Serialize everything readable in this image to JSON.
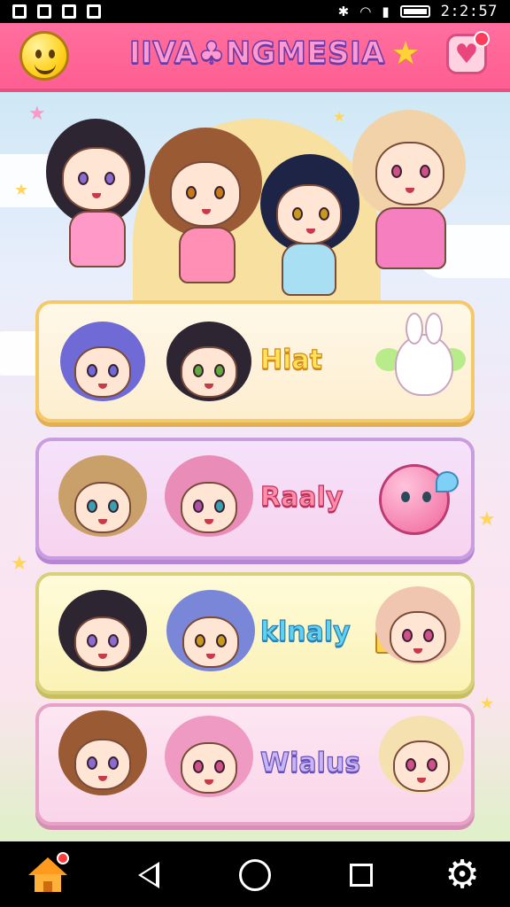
{
  "status_bar": {
    "time": "2:2:57",
    "icons": [
      "image-icon",
      "image-icon",
      "camera-icon",
      "app-icon",
      "bluetooth-icon",
      "wifi-icon",
      "signal-icon",
      "battery-icon"
    ]
  },
  "header": {
    "title": "IIVA♣NGMESIA",
    "left_icon": "smiley-icon",
    "star_icon": "star-icon",
    "right_icon": "heart-icon",
    "notification": true
  },
  "cards": [
    {
      "label": "Hiat",
      "accent": "#f5c96a",
      "right_icon": "bunny-icon"
    },
    {
      "label": "Raaly",
      "accent": "#c99ee0",
      "right_icon": "blob-icon"
    },
    {
      "label": "klnaly",
      "accent": "#d8d07a",
      "right_icon": "tag-icon"
    },
    {
      "label": "Wialus",
      "accent": "#e7a3c7",
      "right_icon": "character-icon"
    }
  ],
  "navbar": {
    "items": [
      "home-icon",
      "back-icon",
      "home-circle-icon",
      "recents-icon",
      "gear-icon"
    ],
    "home_badge": true
  },
  "colors": {
    "header": "#ff6f9f",
    "navbar": "#000000"
  }
}
